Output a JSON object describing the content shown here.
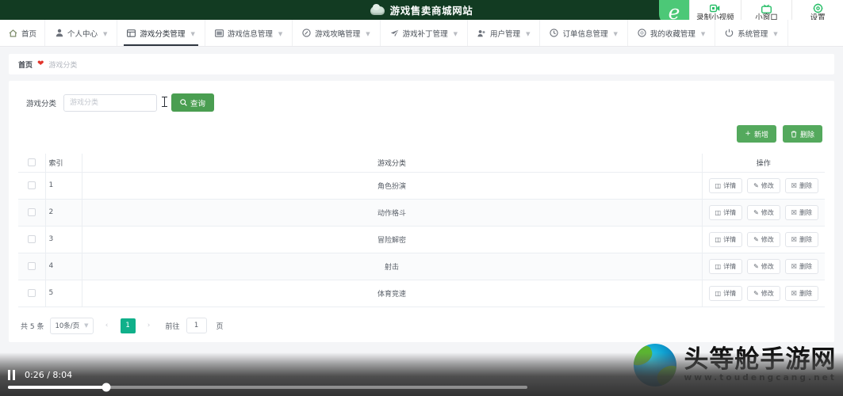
{
  "browser_bar": {
    "logo": "e",
    "items": [
      {
        "label": "录制小视频",
        "icon": "video-record-icon"
      },
      {
        "label": "小窗口",
        "icon": "picture-in-picture-icon"
      },
      {
        "label": "设置",
        "icon": "gear-icon"
      }
    ]
  },
  "header": {
    "title": "游戏售卖商城网站",
    "logo_icon": "cloud-logo-icon"
  },
  "nav": {
    "items": [
      {
        "label": "首页",
        "icon": "home-icon",
        "caret": false,
        "active": false
      },
      {
        "label": "个人中心",
        "icon": "user-icon",
        "caret": true,
        "active": false
      },
      {
        "label": "游戏分类管理",
        "icon": "grid-icon",
        "caret": true,
        "active": true
      },
      {
        "label": "游戏信息管理",
        "icon": "window-icon",
        "caret": true,
        "active": false
      },
      {
        "label": "游戏攻略管理",
        "icon": "compass-icon",
        "caret": true,
        "active": false
      },
      {
        "label": "游戏补丁管理",
        "icon": "send-icon",
        "caret": true,
        "active": false
      },
      {
        "label": "用户管理",
        "icon": "people-icon",
        "caret": true,
        "active": false
      },
      {
        "label": "订单信息管理",
        "icon": "clock-icon",
        "caret": true,
        "active": false
      },
      {
        "label": "我的收藏管理",
        "icon": "circle-icon",
        "caret": true,
        "active": false
      },
      {
        "label": "系统管理",
        "icon": "power-icon",
        "caret": true,
        "active": false
      }
    ]
  },
  "breadcrumb": {
    "home": "首页",
    "separator_icon": "heart-icon",
    "current": "游戏分类"
  },
  "search": {
    "label": "游戏分类",
    "value": "",
    "placeholder": "游戏分类",
    "button_label": "查询",
    "button_icon": "search-icon"
  },
  "actions": {
    "add_label": "新增",
    "add_icon": "plus-icon",
    "delete_label": "删除",
    "delete_icon": "trash-icon"
  },
  "table": {
    "headers": {
      "index": "索引",
      "category": "游戏分类",
      "operations": "操作"
    },
    "row_buttons": {
      "detail": "详情",
      "detail_icon": "doc-icon",
      "edit": "修改",
      "edit_icon": "pencil-icon",
      "delete": "删除",
      "delete_icon": "trash-icon"
    },
    "rows": [
      {
        "index": "1",
        "category": "角色扮演"
      },
      {
        "index": "2",
        "category": "动作格斗"
      },
      {
        "index": "3",
        "category": "冒险解密"
      },
      {
        "index": "4",
        "category": "射击"
      },
      {
        "index": "5",
        "category": "体育竞速"
      }
    ]
  },
  "pagination": {
    "total": "共 5 条",
    "page_size": "10条/页",
    "prev_icon": "chevron-left-icon",
    "next_icon": "chevron-right-icon",
    "current_page": "1",
    "goto_label": "前往",
    "goto_value": "1",
    "page_unit": "页"
  },
  "watermark": {
    "name": "头等舱手游网",
    "url": "www.toudengcang.net"
  },
  "video": {
    "pause_icon": "pause-icon",
    "time": "0:26 / 8:04",
    "progress_percent": 19
  },
  "colors": {
    "header_green": "#123b22",
    "accent_green": "#4a9e51",
    "button_green": "#54a95d",
    "page_active": "#10b08a",
    "browser_green": "#4cc877",
    "heart_red": "#e2342b"
  }
}
